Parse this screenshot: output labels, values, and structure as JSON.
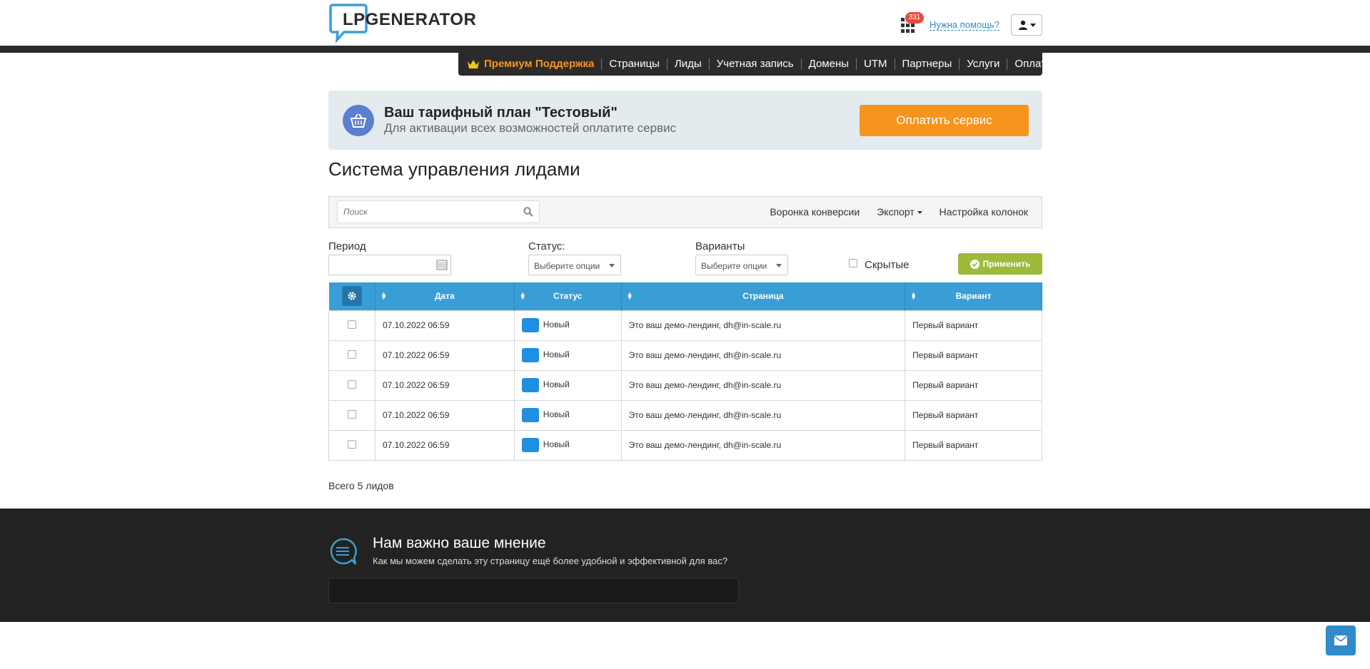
{
  "header": {
    "logo_text": "LPGENERATOR",
    "notifications_count": "331",
    "help_link": "Нужна помощь?"
  },
  "nav": {
    "premium": "Премиум Поддержка",
    "items": [
      "Страницы",
      "Лиды",
      "Учетная запись",
      "Домены",
      "UTM",
      "Партнеры",
      "Услуги",
      "Оплата"
    ]
  },
  "plan": {
    "title": "Ваш тарифный план \"Тестовый\"",
    "subtitle": "Для активации всех возможностей оплатите сервис",
    "pay_button": "Оплатить сервис"
  },
  "page_title": "Система управления лидами",
  "toolbar": {
    "search_placeholder": "Поиск",
    "conversion_funnel": "Воронка конверсии",
    "export": "Экспорт",
    "columns_settings": "Настройка колонок"
  },
  "filters": {
    "period_label": "Период",
    "status_label": "Статус:",
    "status_placeholder": "Выберите опции",
    "variants_label": "Варианты",
    "variants_placeholder": "Выберите опции",
    "hidden_label": "Скрытые",
    "apply_button": "Применить"
  },
  "table": {
    "columns": [
      "Дата",
      "Статус",
      "Страница",
      "Вариант"
    ],
    "rows": [
      {
        "date": "07.10.2022 06:59",
        "status": "Новый",
        "page": "Это ваш демо-лендинг, dh@in-scale.ru",
        "variant": "Первый вариант"
      },
      {
        "date": "07.10.2022 06:59",
        "status": "Новый",
        "page": "Это ваш демо-лендинг, dh@in-scale.ru",
        "variant": "Первый вариант"
      },
      {
        "date": "07.10.2022 06:59",
        "status": "Новый",
        "page": "Это ваш демо-лендинг, dh@in-scale.ru",
        "variant": "Первый вариант"
      },
      {
        "date": "07.10.2022 06:59",
        "status": "Новый",
        "page": "Это ваш демо-лендинг, dh@in-scale.ru",
        "variant": "Первый вариант"
      },
      {
        "date": "07.10.2022 06:59",
        "status": "Новый",
        "page": "Это ваш демо-лендинг, dh@in-scale.ru",
        "variant": "Первый вариант"
      }
    ],
    "status_color": "#1e8fe1",
    "header_color": "#3a9ed6"
  },
  "total": "Всего 5 лидов",
  "feedback": {
    "title": "Нам важно ваше мнение",
    "subtitle": "Как мы можем сделать эту страницу ещё более удобной и эффективной для вас?"
  },
  "colors": {
    "accent_orange": "#f7941d",
    "apply_green": "#9bbb39",
    "link_blue": "#2f8bc9"
  }
}
